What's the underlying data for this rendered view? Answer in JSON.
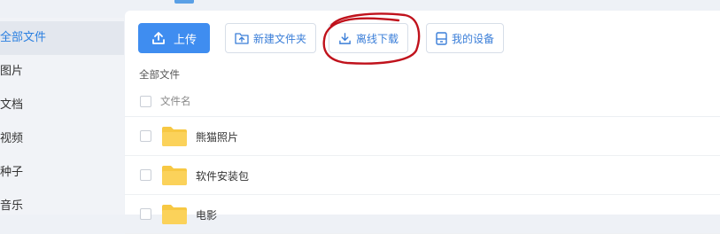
{
  "sidebar": {
    "items": [
      {
        "label": "全部文件",
        "active": true
      },
      {
        "label": "图片",
        "active": false
      },
      {
        "label": "文档",
        "active": false
      },
      {
        "label": "视频",
        "active": false
      },
      {
        "label": "种子",
        "active": false
      },
      {
        "label": "音乐",
        "active": false
      }
    ]
  },
  "toolbar": {
    "upload_label": "上传",
    "new_folder_label": "新建文件夹",
    "offline_download_label": "离线下载",
    "my_devices_label": "我的设备"
  },
  "breadcrumb": {
    "label": "全部文件"
  },
  "list": {
    "header_label": "文件名",
    "rows": [
      {
        "name": "熊猫照片",
        "icon": "folder-icon"
      },
      {
        "name": "软件安装包",
        "icon": "folder-icon"
      },
      {
        "name": "电影",
        "icon": "folder-icon"
      }
    ]
  },
  "colors": {
    "accent": "#3f8df0",
    "annotation": "#c0121c",
    "folder": "#f7c843"
  }
}
